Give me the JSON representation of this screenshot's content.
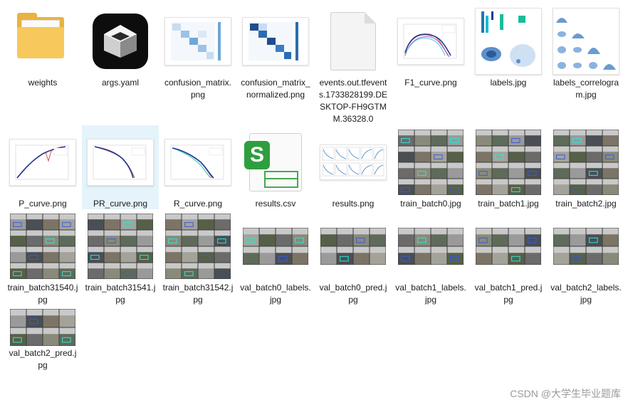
{
  "files": [
    {
      "name": "weights",
      "type": "folder",
      "icon": "folder-icon"
    },
    {
      "name": "args.yaml",
      "type": "yaml",
      "icon": "yaml-app-icon"
    },
    {
      "name": "confusion_matrix.png",
      "type": "png",
      "icon": "confusion-matrix-thumbnail"
    },
    {
      "name": "confusion_matrix_normalized.png",
      "type": "png",
      "icon": "confusion-matrix-normalized-thumbnail"
    },
    {
      "name": "events.out.tfevents.1733828199.DESKTOP-FH9GTMM.36328.0",
      "type": "file",
      "icon": "blank-document-icon"
    },
    {
      "name": "F1_curve.png",
      "type": "png",
      "icon": "curve-thumbnail"
    },
    {
      "name": "labels.jpg",
      "type": "jpg",
      "icon": "labels-thumbnail"
    },
    {
      "name": "labels_correlogram.jpg",
      "type": "jpg",
      "icon": "correlogram-thumbnail"
    },
    {
      "name": "P_curve.png",
      "type": "png",
      "icon": "curve-thumbnail"
    },
    {
      "name": "PR_curve.png",
      "type": "png",
      "icon": "curve-thumbnail",
      "selected": true
    },
    {
      "name": "R_curve.png",
      "type": "png",
      "icon": "curve-thumbnail"
    },
    {
      "name": "results.csv",
      "type": "csv",
      "icon": "spreadsheet-icon"
    },
    {
      "name": "results.png",
      "type": "png",
      "icon": "results-thumbnail"
    },
    {
      "name": "train_batch0.jpg",
      "type": "jpg",
      "icon": "photo-mosaic-thumbnail"
    },
    {
      "name": "train_batch1.jpg",
      "type": "jpg",
      "icon": "photo-mosaic-thumbnail"
    },
    {
      "name": "train_batch2.jpg",
      "type": "jpg",
      "icon": "photo-mosaic-thumbnail"
    },
    {
      "name": "train_batch31540.jpg",
      "type": "jpg",
      "icon": "photo-mosaic-thumbnail"
    },
    {
      "name": "train_batch31541.jpg",
      "type": "jpg",
      "icon": "photo-mosaic-thumbnail"
    },
    {
      "name": "train_batch31542.jpg",
      "type": "jpg",
      "icon": "photo-mosaic-thumbnail"
    },
    {
      "name": "val_batch0_labels.jpg",
      "type": "jpg",
      "icon": "photo-mosaic-thumbnail"
    },
    {
      "name": "val_batch0_pred.jpg",
      "type": "jpg",
      "icon": "photo-mosaic-thumbnail"
    },
    {
      "name": "val_batch1_labels.jpg",
      "type": "jpg",
      "icon": "photo-mosaic-thumbnail"
    },
    {
      "name": "val_batch1_pred.jpg",
      "type": "jpg",
      "icon": "photo-mosaic-thumbnail"
    },
    {
      "name": "val_batch2_labels.jpg",
      "type": "jpg",
      "icon": "photo-mosaic-thumbnail"
    },
    {
      "name": "val_batch2_pred.jpg",
      "type": "jpg",
      "icon": "photo-mosaic-thumbnail"
    }
  ],
  "watermark": "CSDN @大学生毕业题库",
  "colors": {
    "selection": "#e5f3fb",
    "folder": "#e8b33f",
    "csv_green": "#2f9e3f",
    "matrix_blue": "#2b6cb0"
  }
}
